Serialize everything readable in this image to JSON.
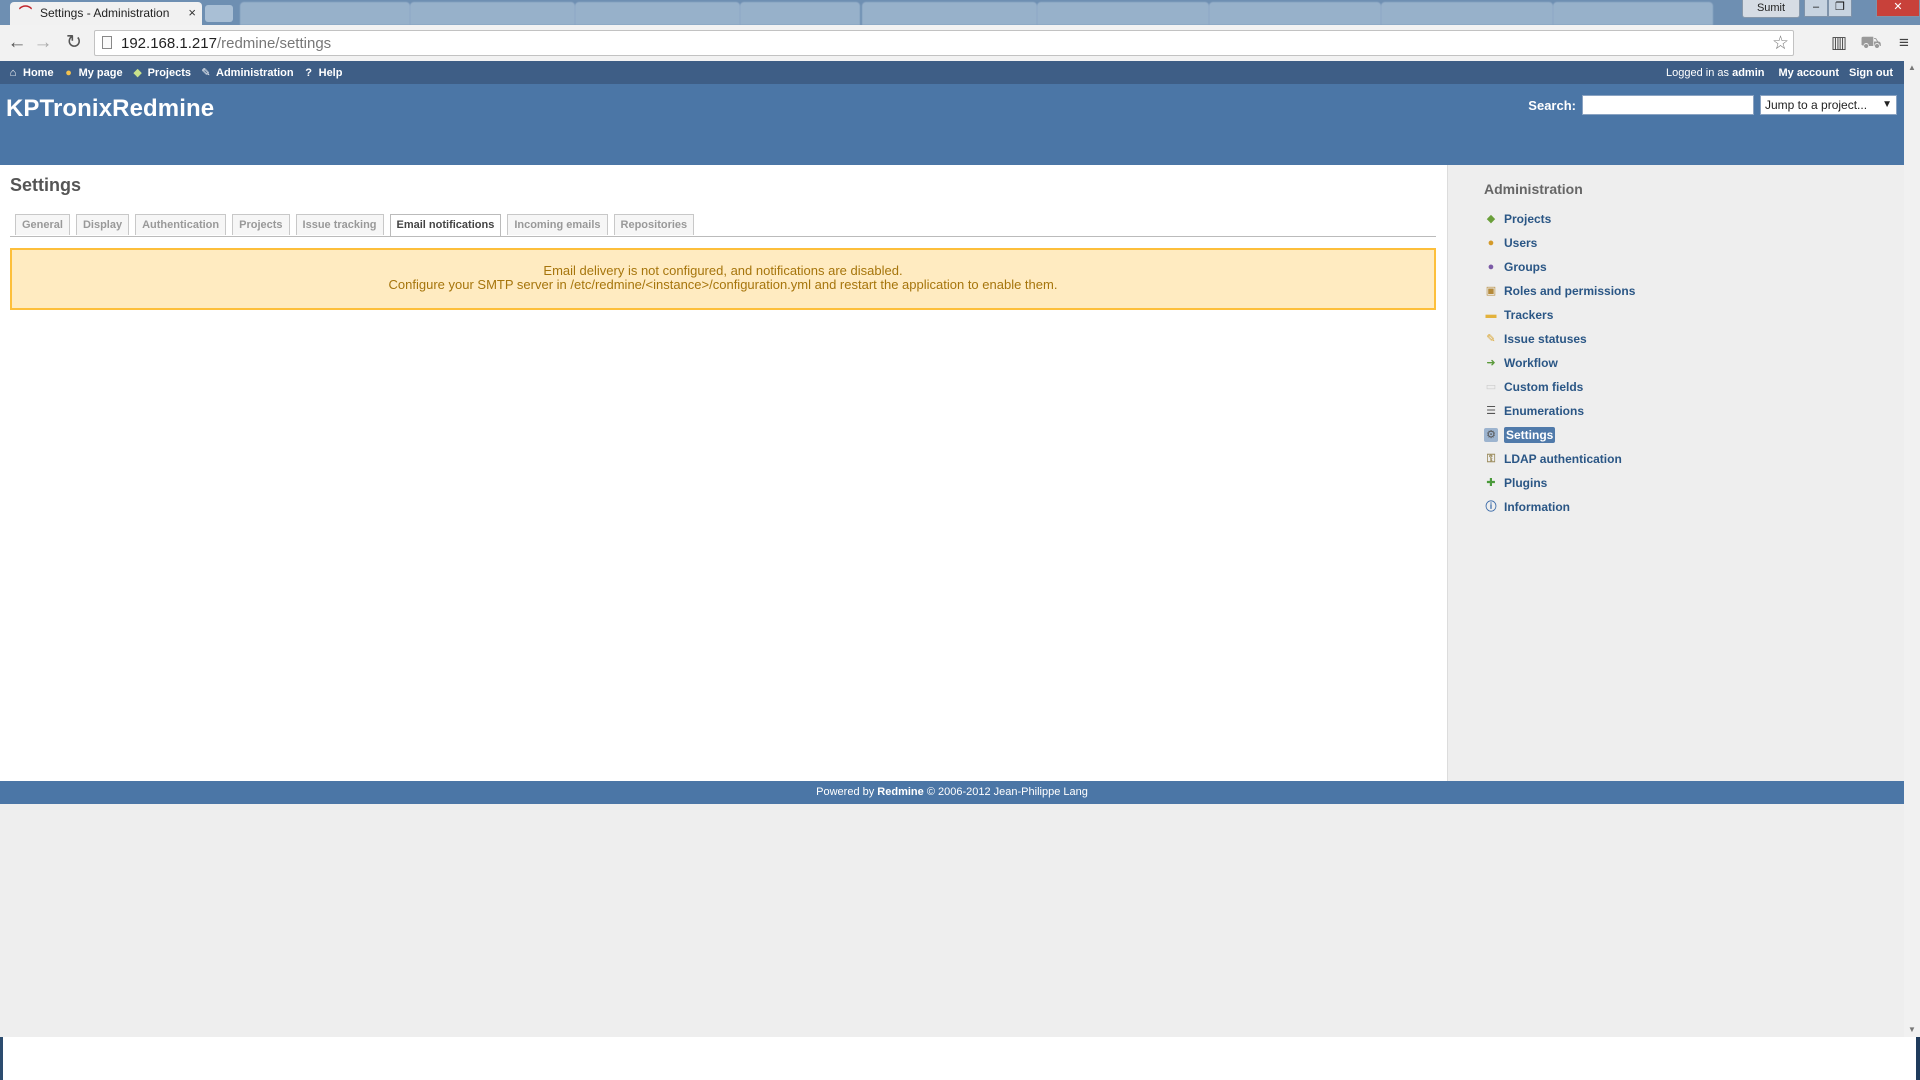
{
  "browser": {
    "active_tab_title": "Settings - Administration",
    "tab_close": "×",
    "user_badge": "Sumit",
    "url_host": "192.168.1.217",
    "url_path": "/redmine/settings",
    "background_tabs": [
      "",
      "",
      "",
      "",
      "",
      "",
      "",
      "",
      ""
    ]
  },
  "top_menu": {
    "home": "Home",
    "my_page": "My page",
    "projects": "Projects",
    "administration": "Administration",
    "help": "Help",
    "logged_prefix": "Logged in as",
    "logged_user": "admin",
    "my_account": "My account",
    "sign_out": "Sign out"
  },
  "header": {
    "site_title": "KPTronixRedmine",
    "search_label": "Search:",
    "search_value": "",
    "jump_select": "Jump to a project..."
  },
  "content": {
    "title": "Settings",
    "tabs": [
      {
        "label": "General",
        "selected": false
      },
      {
        "label": "Display",
        "selected": false
      },
      {
        "label": "Authentication",
        "selected": false
      },
      {
        "label": "Projects",
        "selected": false
      },
      {
        "label": "Issue tracking",
        "selected": false
      },
      {
        "label": "Email notifications",
        "selected": true
      },
      {
        "label": "Incoming emails",
        "selected": false
      },
      {
        "label": "Repositories",
        "selected": false
      }
    ],
    "warning_line1": "Email delivery is not configured, and notifications are disabled.",
    "warning_line2": "Configure your SMTP server in /etc/redmine/<instance>/configuration.yml and restart the application to enable them."
  },
  "sidebar": {
    "title": "Administration",
    "items": [
      {
        "label": "Projects",
        "icon": "projects-icon",
        "selected": false
      },
      {
        "label": "Users",
        "icon": "user-icon",
        "selected": false
      },
      {
        "label": "Groups",
        "icon": "group-icon",
        "selected": false
      },
      {
        "label": "Roles and permissions",
        "icon": "permissions-icon",
        "selected": false
      },
      {
        "label": "Trackers",
        "icon": "folder-icon",
        "selected": false
      },
      {
        "label": "Issue statuses",
        "icon": "status-icon",
        "selected": false
      },
      {
        "label": "Workflow",
        "icon": "workflow-icon",
        "selected": false
      },
      {
        "label": "Custom fields",
        "icon": "custom-fields-icon",
        "selected": false
      },
      {
        "label": "Enumerations",
        "icon": "list-icon",
        "selected": false
      },
      {
        "label": "Settings",
        "icon": "settings-icon",
        "selected": true
      },
      {
        "label": "LDAP authentication",
        "icon": "ldap-icon",
        "selected": false
      },
      {
        "label": "Plugins",
        "icon": "plugin-icon",
        "selected": false
      },
      {
        "label": "Information",
        "icon": "info-icon",
        "selected": false
      }
    ]
  },
  "footer": {
    "powered_by": "Powered by",
    "product": "Redmine",
    "copyright": "© 2006-2012 Jean-Philippe Lang"
  },
  "colors": {
    "header_blue": "#4b76a6",
    "top_menu_blue": "#3e5e86",
    "link_blue": "#2a5685",
    "warning_bg": "#ffebc1",
    "warning_border": "#fdbf3b",
    "warning_text": "#a6750c"
  }
}
